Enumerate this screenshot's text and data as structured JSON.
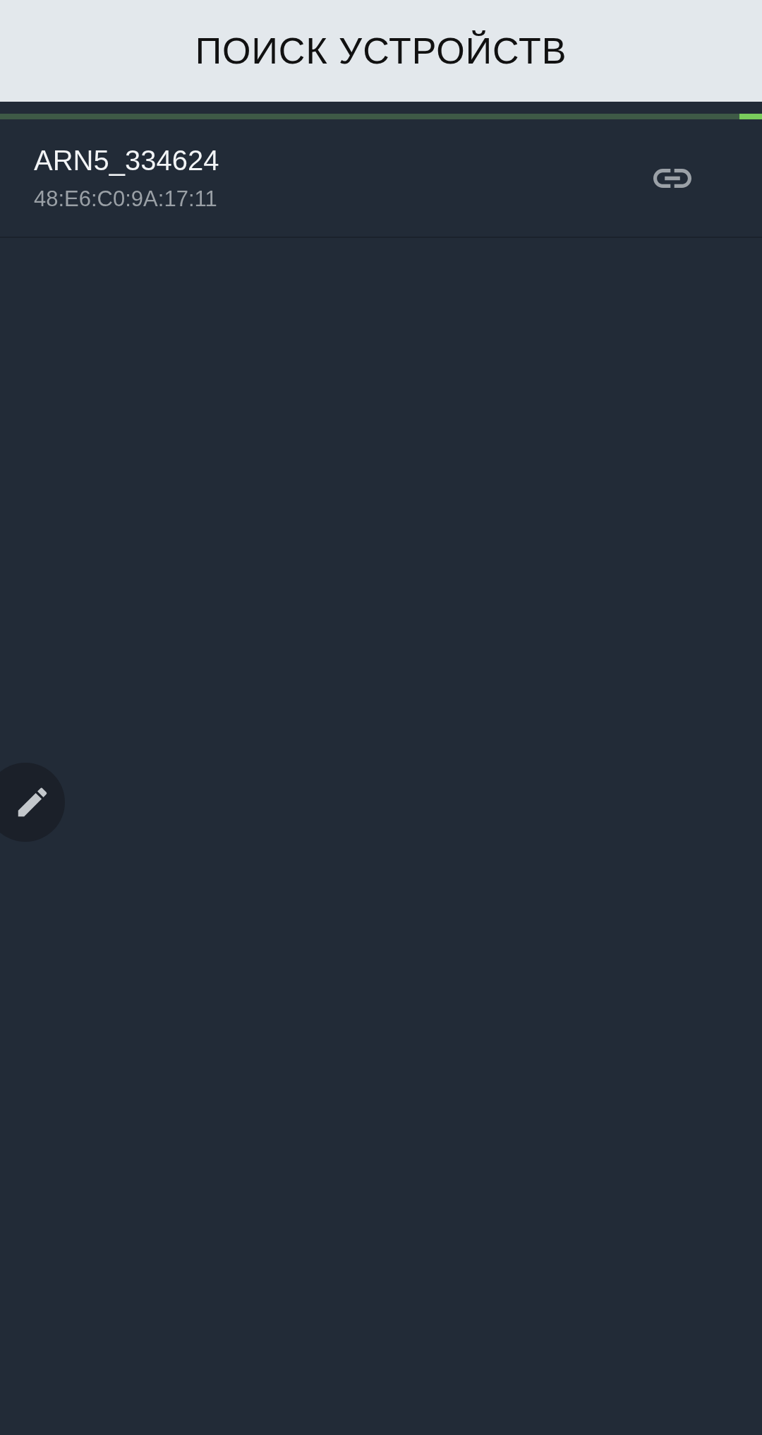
{
  "header": {
    "title": "ПОИСК УСТРОЙСТВ"
  },
  "progress": {
    "level": 0.03
  },
  "devices": [
    {
      "name": "ARN5_334624",
      "address": "48:E6:C0:9A:17:11"
    }
  ]
}
